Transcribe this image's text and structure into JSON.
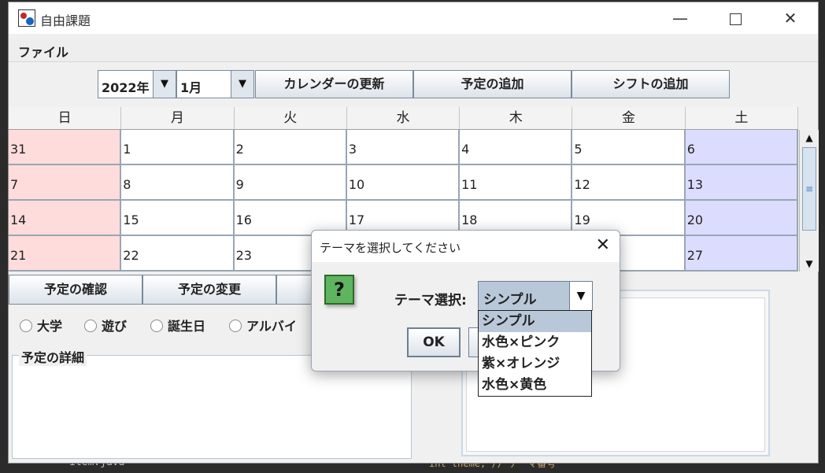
{
  "window": {
    "title": "自由課題"
  },
  "menu": {
    "file": "ファイル"
  },
  "toolbar": {
    "year": "2022年",
    "month": "1月",
    "refresh": "カレンダーの更新",
    "add_event": "予定の追加",
    "add_shift": "シフトの追加"
  },
  "calendar": {
    "weekdays": [
      "日",
      "月",
      "火",
      "水",
      "木",
      "金",
      "土"
    ],
    "rows": [
      [
        "31",
        "1",
        "2",
        "3",
        "4",
        "5",
        "6"
      ],
      [
        "7",
        "8",
        "9",
        "10",
        "11",
        "12",
        "13"
      ],
      [
        "14",
        "15",
        "16",
        "17",
        "18",
        "19",
        "20"
      ],
      [
        "21",
        "22",
        "23",
        "",
        "",
        "",
        "27"
      ]
    ],
    "colors": {
      "sunday": "#ffdcdc",
      "saturday": "#dcdcff"
    }
  },
  "actions": {
    "confirm": "予定の確認",
    "change": "予定の変更"
  },
  "categories": [
    "大学",
    "遊び",
    "誕生日",
    "アルバイ"
  ],
  "detail": {
    "legend": "予定の詳細"
  },
  "dialog": {
    "title": "テーマを選択してください",
    "label": "テーマ選択:",
    "selected": "シンプル",
    "ok": "OK",
    "options": [
      "シンプル",
      "水色×ピンク",
      "紫×オレンジ",
      "水色×黄色"
    ]
  },
  "background": {
    "file_name": "item.java",
    "code_fragment": "int  theme; // テーマ番号"
  }
}
